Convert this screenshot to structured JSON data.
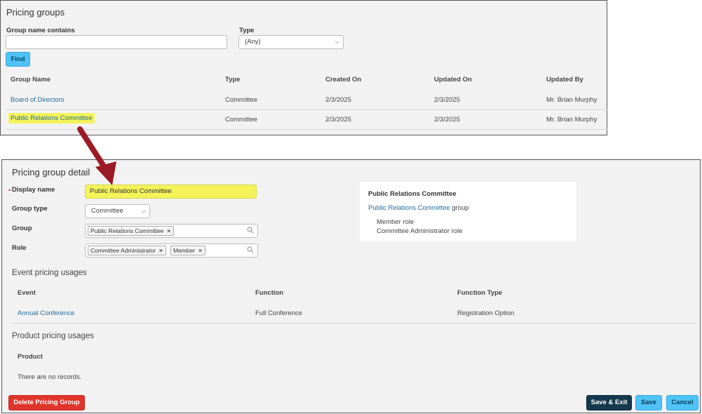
{
  "search": {
    "title": "Pricing groups",
    "name_label": "Group name contains",
    "name_value": "",
    "type_label": "Type",
    "type_value": "(Any)",
    "find_label": "Find",
    "columns": [
      "Group Name",
      "Type",
      "Created On",
      "Updated On",
      "Updated By"
    ],
    "rows": [
      {
        "name": "Board of Directors",
        "type": "Committee",
        "created": "2/3/2025",
        "updated": "2/3/2025",
        "by": "Mr. Brian Murphy"
      },
      {
        "name": "Public Relations Committee",
        "type": "Committee",
        "created": "2/3/2025",
        "updated": "2/3/2025",
        "by": "Mr. Brian Murphy"
      }
    ]
  },
  "detail": {
    "title": "Pricing group detail",
    "display_name_label": "Display name",
    "display_name_value": "Public Relations Committee",
    "group_type_label": "Group type",
    "group_type_value": "Committee",
    "group_label": "Group",
    "group_tags": [
      "Public Relations Committee"
    ],
    "role_label": "Role",
    "role_tags": [
      "Committee Administrator",
      "Member"
    ],
    "summary": {
      "title": "Public Relations Committee",
      "group_link": "Public Relations Committee",
      "group_suffix": "group",
      "roles": [
        "Member role",
        "Committee Administrator role"
      ]
    },
    "event_section_title": "Event pricing usages",
    "event_columns": [
      "Event",
      "Function",
      "Function Type"
    ],
    "event_rows": [
      {
        "event": "Annual Conference",
        "function": "Full Conference",
        "function_type": "Registration Option"
      }
    ],
    "product_section_title": "Product pricing usages",
    "product_column": "Product",
    "product_empty": "There are no records.",
    "buttons": {
      "delete": "Delete Pricing Group",
      "save_exit": "Save & Exit",
      "save": "Save",
      "cancel": "Cancel"
    }
  },
  "colors": {
    "highlight": "#f4f35a",
    "link": "#1f6b9e",
    "primary_button": "#4fc3f7",
    "danger_button": "#e0352b",
    "dark_button": "#15394d",
    "arrow": "#9b1b24"
  }
}
